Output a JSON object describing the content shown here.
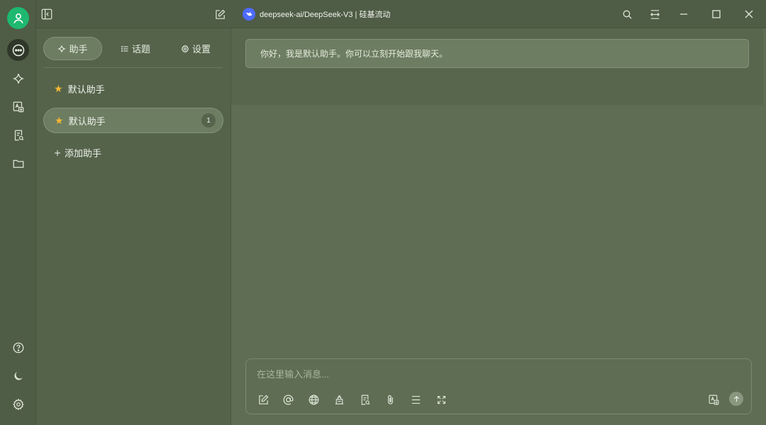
{
  "app": {
    "model_title": "deepseek-ai/DeepSeek-V3 | 硅基流动"
  },
  "rail": {
    "items": [
      {
        "icon": "user-avatar-icon"
      },
      {
        "icon": "chat-icon",
        "active": true
      },
      {
        "icon": "sparkle-icon"
      },
      {
        "icon": "translate-icon"
      },
      {
        "icon": "document-search-icon"
      },
      {
        "icon": "folder-icon"
      }
    ],
    "bottom": [
      {
        "icon": "help-icon"
      },
      {
        "icon": "moon-icon"
      },
      {
        "icon": "gear-icon"
      }
    ]
  },
  "panel": {
    "tabs": [
      {
        "label": "助手",
        "icon": "sparkle-icon",
        "active": true
      },
      {
        "label": "话题",
        "icon": "list-icon"
      },
      {
        "label": "设置",
        "icon": "gear-icon"
      }
    ],
    "assistants": [
      {
        "name": "默认助手",
        "icon": "star-icon"
      },
      {
        "name": "默认助手",
        "icon": "star-icon",
        "badge": "1",
        "selected": true
      }
    ],
    "add_label": "添加助手"
  },
  "chat": {
    "welcome": "你好，我是默认助手。你可以立刻开始跟我聊天。",
    "input_placeholder": "在这里输入消息..."
  },
  "colors": {
    "accent": "#1eb870",
    "star": "#f2b733",
    "model_logo": "#4d6bfe"
  }
}
